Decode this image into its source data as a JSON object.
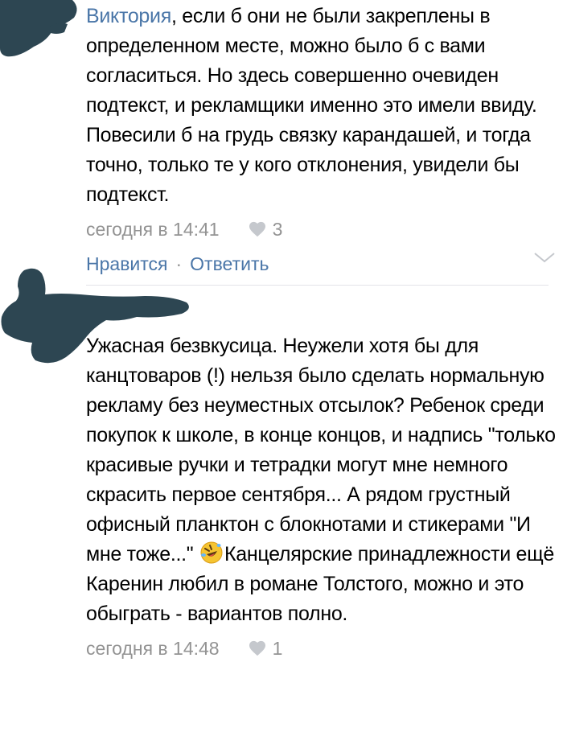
{
  "comment1": {
    "author": "Виктория",
    "text": ", если б они не были закреплены в определенном месте, можно было б с вами согласиться. Но здесь совершенно очевиден подтекст, и рекламщики именно это имели ввиду. Повесили б на грудь связку карандашей, и тогда точно, только те у кого отклонения, увидели бы подтекст.",
    "time": "сегодня в 14:41",
    "likes": "3",
    "like_action": "Нравится",
    "separator": "·",
    "reply_action": "Ответить"
  },
  "comment2": {
    "text_before_emoji": "Ужасная безвкусица. Неужели хотя бы для канцтоваров (!) нельзя было сделать нормальную рекламу без неуместных отсылок? Ребенок среди покупок к школе, в конце концов, и надпись \"только красивые ручки и тетрадки могут мне немного скрасить первое сентября... А рядом грустный офисный планктон с блокнотами и стикерами \"И мне тоже...\" ",
    "emoji": "rolling-on-floor-laughing-emoji",
    "text_after_emoji": "Канцелярские принадлежности ещё Каренин любил в романе Толстого, можно и это обыграть - вариантов полно.",
    "time": "сегодня в 14:48",
    "likes": "1"
  },
  "colors": {
    "link": "#4a76a8",
    "meta": "#939393",
    "redaction": "#2d4652",
    "divider": "#e3e4e8"
  },
  "icons": {
    "like": "heart-icon",
    "expand": "chevron-down-icon"
  }
}
